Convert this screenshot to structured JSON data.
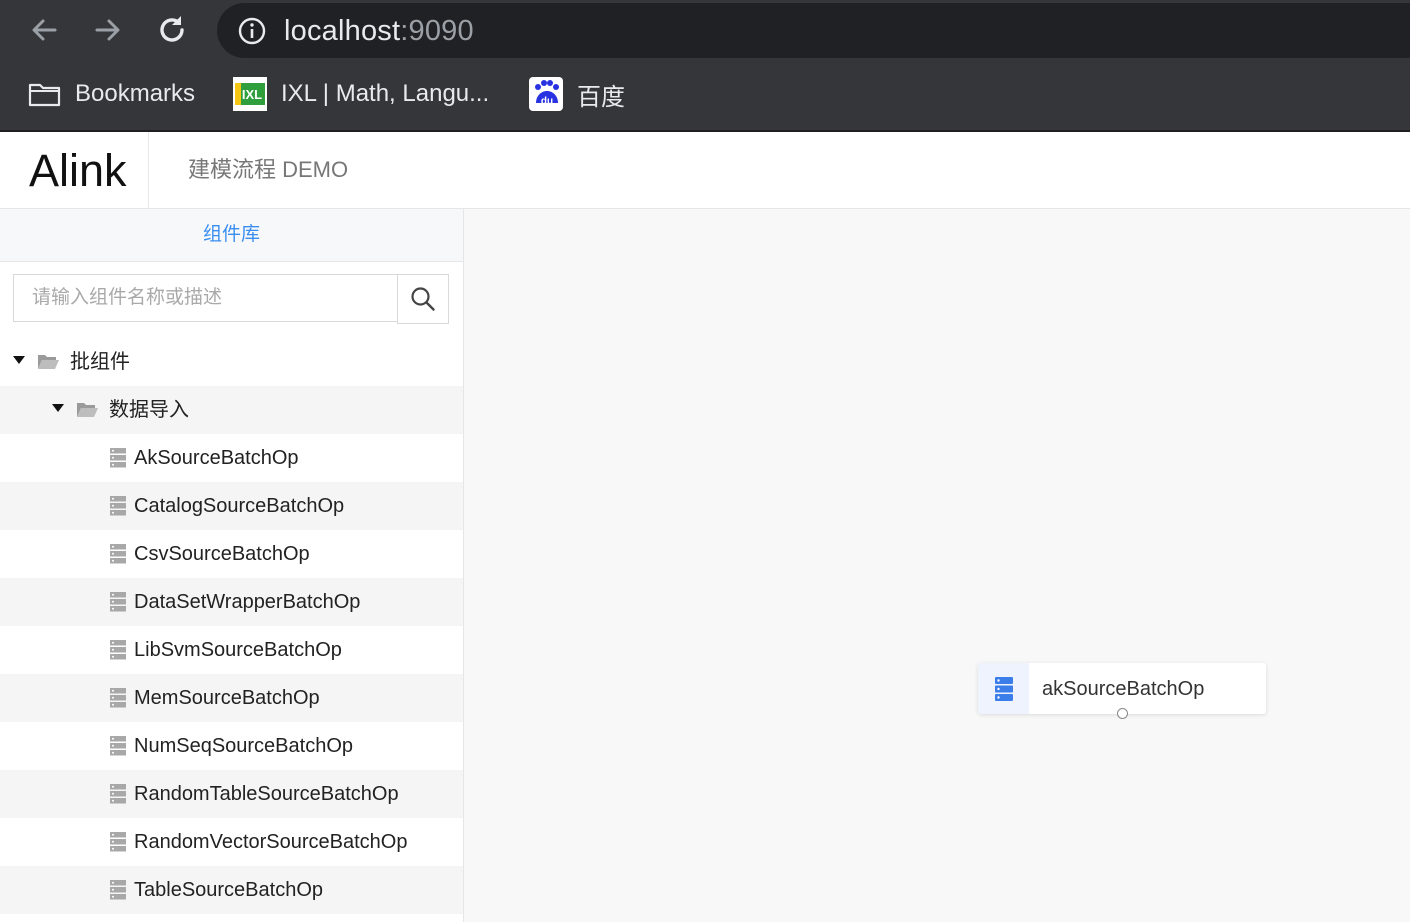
{
  "browser": {
    "url_host": "localhost",
    "url_port": ":9090",
    "bookmarks": [
      {
        "label": "Bookmarks",
        "icon": "folder-icon"
      },
      {
        "label": "IXL | Math, Langu...",
        "icon": "ixl-logo"
      },
      {
        "label": "百度",
        "icon": "baidu-logo"
      }
    ],
    "ixl_logo_text": "IXL",
    "baidu_logo_text": "du"
  },
  "header": {
    "brand": "Alink",
    "title": "建模流程 DEMO"
  },
  "sidebar": {
    "tab_label": "组件库",
    "search": {
      "placeholder": "请输入组件名称或描述",
      "value": ""
    },
    "tree": {
      "root": {
        "label": "批组件",
        "expanded": true
      },
      "group": {
        "label": "数据导入",
        "expanded": true
      },
      "items": [
        "AkSourceBatchOp",
        "CatalogSourceBatchOp",
        "CsvSourceBatchOp",
        "DataSetWrapperBatchOp",
        "LibSvmSourceBatchOp",
        "MemSourceBatchOp",
        "NumSeqSourceBatchOp",
        "RandomTableSourceBatchOp",
        "RandomVectorSourceBatchOp",
        "TableSourceBatchOp"
      ]
    }
  },
  "canvas": {
    "nodes": [
      {
        "label": "akSourceBatchOp",
        "icon": "database-icon"
      }
    ]
  },
  "colors": {
    "accent": "#3b8ef0",
    "chrome_bg": "#35363a",
    "address_bg": "#202124"
  }
}
